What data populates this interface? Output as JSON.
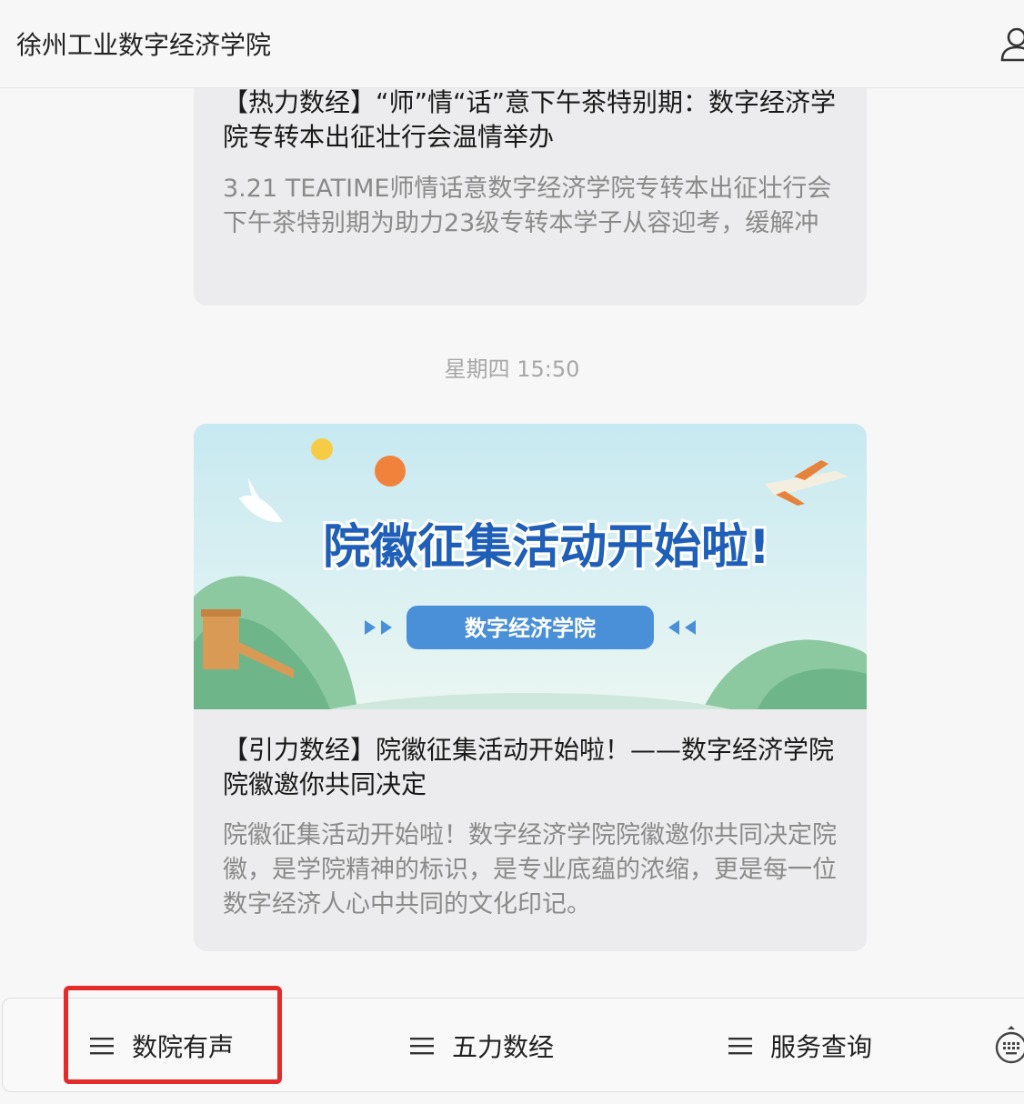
{
  "header": {
    "title": "徐州工业数字经济学院"
  },
  "messages": [
    {
      "title": "【热力数经】“师”情“话”意下午茶特别期：数字经济学院专转本出征壮行会温情举办",
      "description": "3.21 TEATIME师情话意数字经济学院专转本出征壮行会下午茶特别期为助力23级专转本学子从容迎考，缓解冲"
    },
    {
      "timestamp": "星期四 15:50",
      "banner": {
        "headline": "院徽征集活动开始啦!",
        "badge": "数字经济学院"
      },
      "title": "【引力数经】院徽征集活动开始啦！——数字经济学院院徽邀你共同决定",
      "description": "院徽征集活动开始啦！数字经济学院院徽邀你共同决定院徽，是学院精神的标识，是专业底蕴的浓缩，更是每一位数字经济人心中共同的文化印记。"
    }
  ],
  "menu": {
    "items": [
      {
        "label": "数院有声",
        "icon": "menu-icon"
      },
      {
        "label": "五力数经",
        "icon": "menu-icon"
      },
      {
        "label": "服务查询",
        "icon": "menu-icon"
      }
    ],
    "keyboard_icon": "keyboard-icon"
  },
  "colors": {
    "highlight": "#e52a2a",
    "banner_headline": "#1f5fb8",
    "banner_badge": "#4a90d9"
  }
}
